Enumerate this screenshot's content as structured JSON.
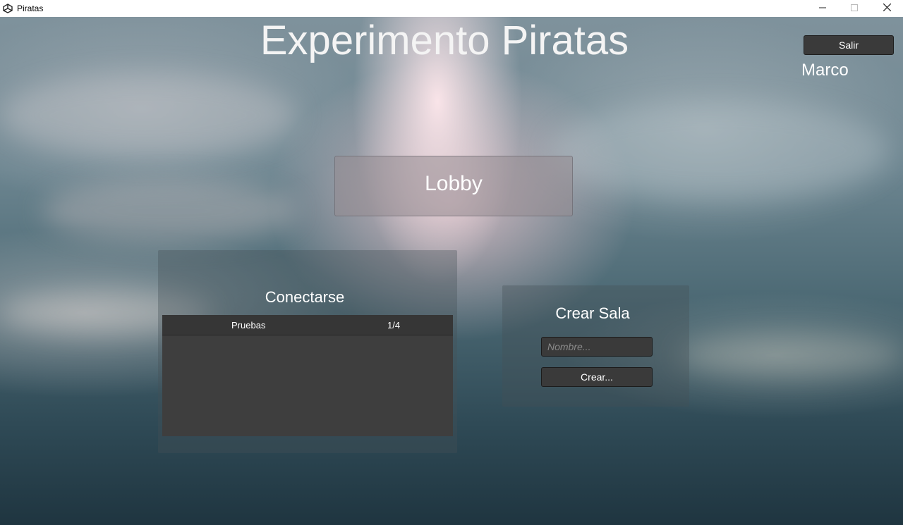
{
  "window": {
    "title": "Piratas",
    "controls": {
      "minimize": "minimize-icon",
      "maximize": "maximize-icon",
      "close": "close-icon"
    }
  },
  "header": {
    "title": "Experimento Piratas",
    "exit_label": "Salir",
    "username": "Marco"
  },
  "lobby": {
    "label": "Lobby"
  },
  "connect": {
    "title": "Conectarse",
    "rooms": [
      {
        "name": "Pruebas",
        "players": "1/4"
      }
    ]
  },
  "create_room": {
    "title": "Crear Sala",
    "name_placeholder": "Nombre...",
    "name_value": "",
    "create_label": "Crear..."
  },
  "colors": {
    "panel_dark": "#3a3a3a",
    "text": "#ffffff"
  }
}
